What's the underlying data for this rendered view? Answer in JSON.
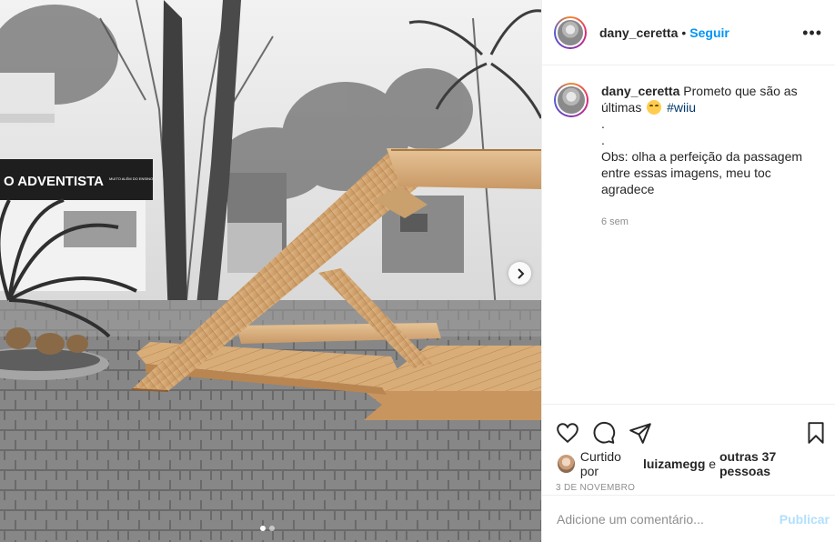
{
  "post": {
    "username": "dany_ceretta",
    "separator": "•",
    "follow_label": "Seguir",
    "more_icon": "more-options-icon",
    "more_glyph": "•••"
  },
  "photo": {
    "sign_text": "O ADVENTISTA",
    "sign_small_text": "MUITO ALÉM DO ENSINO",
    "next_icon": "chevron-right-icon",
    "carousel_count": 2,
    "carousel_active": 1
  },
  "caption": {
    "username": "dany_ceretta",
    "text_1": "Prometo que são as últimas",
    "emoji": "grinning-face-emoji",
    "hashtag": "#wiiu",
    "dot_1": ".",
    "dot_2": ".",
    "obs": "Obs: olha a perfeição da passagem entre essas imagens, meu toc agradece",
    "time_ago": "6 sem"
  },
  "actions": {
    "like_icon": "heart-icon",
    "comment_icon": "comment-icon",
    "share_icon": "share-icon",
    "save_icon": "bookmark-icon"
  },
  "likes": {
    "prefix": "Curtido por",
    "user": "luizamegg",
    "connector": "e",
    "others": "outras 37 pessoas"
  },
  "date": "3 DE NOVEMBRO",
  "comment": {
    "placeholder": "Adicione um comentário...",
    "post_label": "Publicar"
  },
  "colors": {
    "link_blue": "#0095f6",
    "hashtag_blue": "#00376b",
    "muted": "#8e8e8e",
    "post_disabled": "#b2dffc"
  }
}
